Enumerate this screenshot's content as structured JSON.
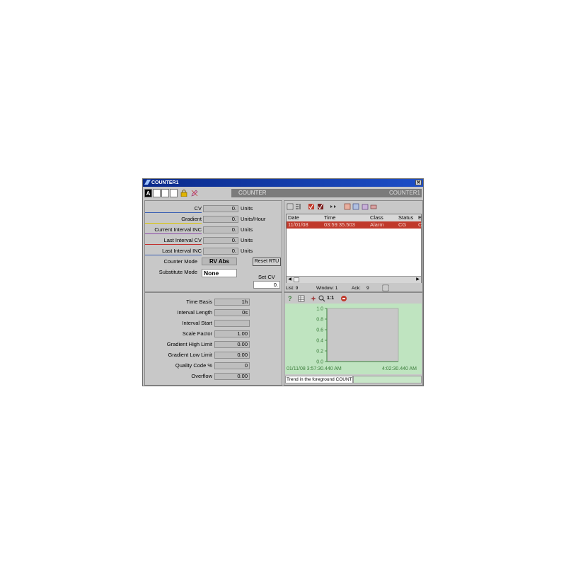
{
  "window": {
    "title": "COUNTER1",
    "close_icon": "close-icon"
  },
  "toolbar": {
    "a_button": "A",
    "tag_left": "COUNTER",
    "tag_right": "COUNTER1"
  },
  "counter_fields": [
    {
      "label": "CV",
      "value": "0.",
      "unit": "Units"
    },
    {
      "label": "Gradient",
      "value": "0.",
      "unit": "Units/Hour"
    },
    {
      "label": "Current Interval INC",
      "value": "0.",
      "unit": "Units"
    },
    {
      "label": "Last Interval CV",
      "value": "0.",
      "unit": "Units"
    },
    {
      "label": "Last Interval INC",
      "value": "0.",
      "unit": "Units"
    }
  ],
  "counter_mode": {
    "label": "Counter Mode",
    "value": "RV Abs"
  },
  "substitute_mode": {
    "label": "Substitute Mode",
    "value": "None"
  },
  "reset_rtu": "Reset RTU",
  "set_cv": {
    "label": "Set CV",
    "value": "0."
  },
  "settings": [
    {
      "label": "Time Basis",
      "value": "1h"
    },
    {
      "label": "Interval Length",
      "value": "0s"
    },
    {
      "label": "Interval Start",
      "value": ""
    },
    {
      "label": "Scale Factor",
      "value": "1.00"
    },
    {
      "label": "Gradient High Limit",
      "value": "0.00"
    },
    {
      "label": "Gradient Low Limit",
      "value": "0.00"
    },
    {
      "label": "Quality Code %",
      "value": "0"
    },
    {
      "label": "Overflow",
      "value": "0.00"
    }
  ],
  "alarm_list": {
    "headers": [
      "Date",
      "Time",
      "Class",
      "Status",
      "E"
    ],
    "rows": [
      {
        "date": "11/01/08",
        "time": "03:59:35.503",
        "class": "Alarm",
        "status": "CG",
        "extra": "C"
      }
    ],
    "row_color": "#c0392b",
    "status": {
      "list": "List: 9",
      "window": "Window: 1",
      "ack": "Ack:",
      "ack_count": "9"
    }
  },
  "trend": {
    "zoom_label": "1:1",
    "y_ticks": [
      "1.0",
      "0.8",
      "0.6",
      "0.4",
      "0.2",
      "0.0"
    ],
    "x_start": "01/11/08  3:57:30.440 AM",
    "x_end": "4:02:30.440 AM",
    "status_text": "Trend in the foreground COUNTI",
    "line_color": "#3b7d3b"
  }
}
